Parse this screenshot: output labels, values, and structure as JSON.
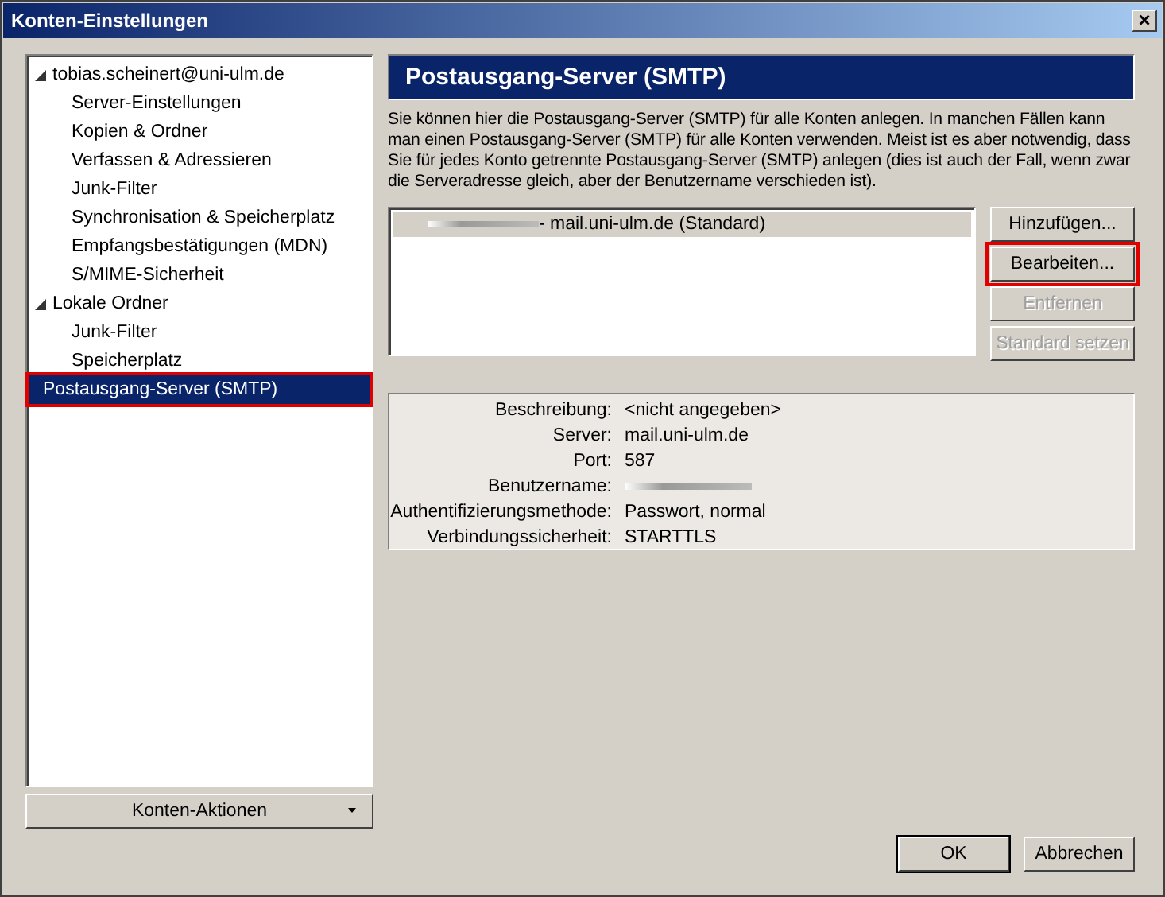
{
  "window": {
    "title": "Konten-Einstellungen",
    "close": "×"
  },
  "tree": [
    {
      "label": "tobias.scheinert@uni-ulm.de",
      "expanded": true,
      "selected": false,
      "highlighted": false,
      "children": [
        {
          "label": "Server-Einstellungen",
          "selected": false,
          "highlighted": false
        },
        {
          "label": "Kopien & Ordner",
          "selected": false,
          "highlighted": false
        },
        {
          "label": "Verfassen & Adressieren",
          "selected": false,
          "highlighted": false
        },
        {
          "label": "Junk-Filter",
          "selected": false,
          "highlighted": false
        },
        {
          "label": "Synchronisation & Speicherplatz",
          "selected": false,
          "highlighted": false
        },
        {
          "label": "Empfangsbestätigungen (MDN)",
          "selected": false,
          "highlighted": false
        },
        {
          "label": "S/MIME-Sicherheit",
          "selected": false,
          "highlighted": false
        }
      ]
    },
    {
      "label": "Lokale Ordner",
      "expanded": true,
      "selected": false,
      "highlighted": false,
      "children": [
        {
          "label": "Junk-Filter",
          "selected": false,
          "highlighted": false
        },
        {
          "label": "Speicherplatz",
          "selected": false,
          "highlighted": false
        }
      ]
    },
    {
      "label": "Postausgang-Server (SMTP)",
      "selected": true,
      "highlighted": true
    }
  ],
  "account_actions": {
    "label": "Konten-Aktionen"
  },
  "panel": {
    "title": "Postausgang-Server (SMTP)",
    "description": "Sie können hier die Postausgang-Server (SMTP) für alle Konten anlegen. In manchen Fällen kann man einen Postausgang-Server (SMTP) für alle Konten verwenden. Meist ist es aber notwendig, dass Sie für jedes Konto getrennte Postausgang-Server (SMTP) anlegen (dies ist auch der Fall, wenn zwar die Serveradresse gleich, aber der Benutzername verschieden ist).",
    "servers": [
      {
        "label": "- mail.uni-ulm.de (Standard)",
        "redacted": true,
        "selected": true
      }
    ],
    "buttons": [
      {
        "label": "Hinzufügen...",
        "disabled": false,
        "highlighted": false
      },
      {
        "label": "Bearbeiten...",
        "disabled": false,
        "highlighted": true
      },
      {
        "label": "Entfernen",
        "disabled": true,
        "highlighted": false
      },
      {
        "label": "Standard setzen",
        "disabled": true,
        "highlighted": false
      }
    ],
    "details": [
      {
        "label": "Beschreibung:",
        "value": "<nicht angegeben>",
        "redacted": false
      },
      {
        "label": "Server:",
        "value": "mail.uni-ulm.de",
        "redacted": false
      },
      {
        "label": "Port:",
        "value": "587",
        "redacted": false
      },
      {
        "label": "Benutzername:",
        "redacted": true
      },
      {
        "label": "Authentifizierungsmethode:",
        "value": "Passwort, normal",
        "redacted": false
      },
      {
        "label": "Verbindungssicherheit:",
        "value": "STARTTLS",
        "redacted": false
      }
    ]
  },
  "footer": {
    "buttons": [
      {
        "label": "OK",
        "default": true
      },
      {
        "label": "Abbrechen",
        "default": false
      }
    ]
  }
}
